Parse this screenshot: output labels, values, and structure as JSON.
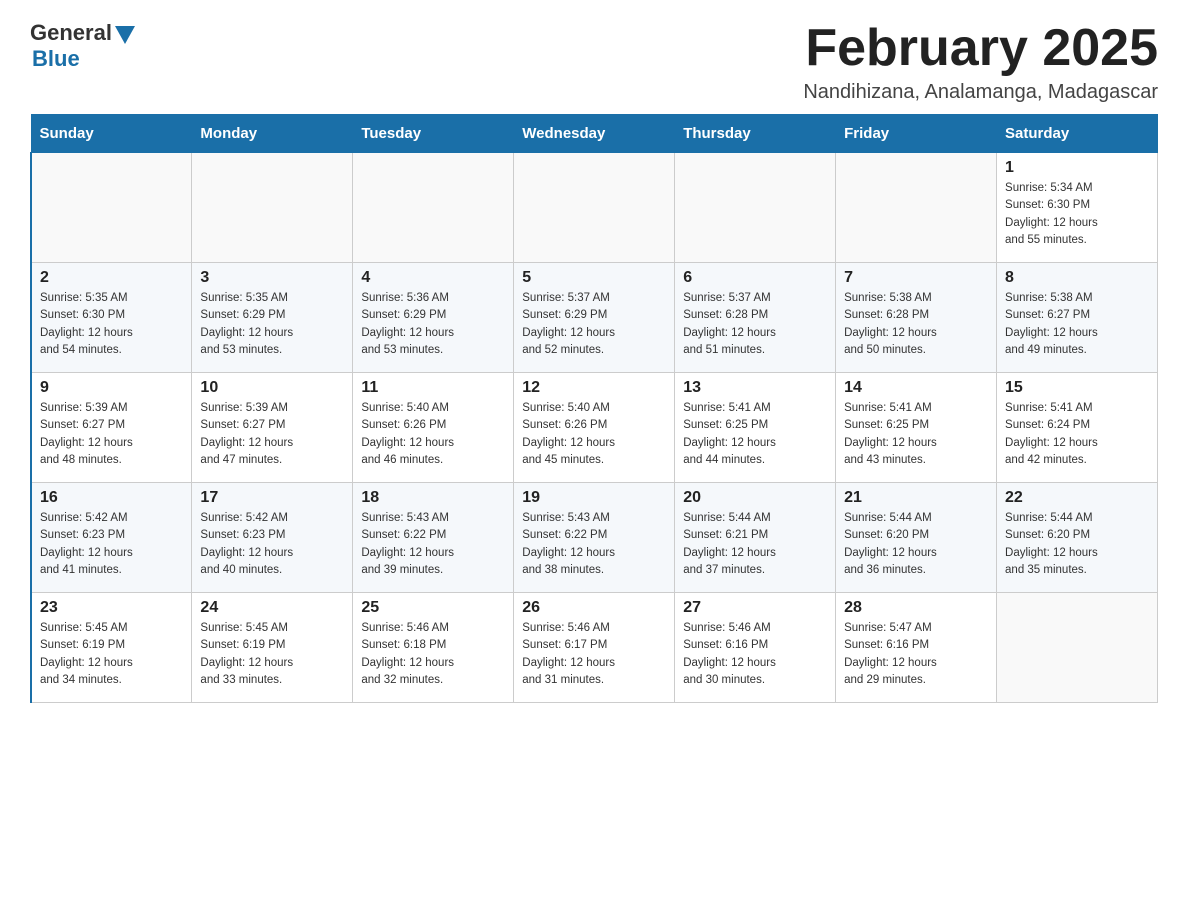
{
  "header": {
    "logo_general": "General",
    "logo_blue": "Blue",
    "month_title": "February 2025",
    "location": "Nandihizana, Analamanga, Madagascar"
  },
  "weekdays": [
    "Sunday",
    "Monday",
    "Tuesday",
    "Wednesday",
    "Thursday",
    "Friday",
    "Saturday"
  ],
  "weeks": [
    [
      {
        "day": "",
        "info": ""
      },
      {
        "day": "",
        "info": ""
      },
      {
        "day": "",
        "info": ""
      },
      {
        "day": "",
        "info": ""
      },
      {
        "day": "",
        "info": ""
      },
      {
        "day": "",
        "info": ""
      },
      {
        "day": "1",
        "info": "Sunrise: 5:34 AM\nSunset: 6:30 PM\nDaylight: 12 hours\nand 55 minutes."
      }
    ],
    [
      {
        "day": "2",
        "info": "Sunrise: 5:35 AM\nSunset: 6:30 PM\nDaylight: 12 hours\nand 54 minutes."
      },
      {
        "day": "3",
        "info": "Sunrise: 5:35 AM\nSunset: 6:29 PM\nDaylight: 12 hours\nand 53 minutes."
      },
      {
        "day": "4",
        "info": "Sunrise: 5:36 AM\nSunset: 6:29 PM\nDaylight: 12 hours\nand 53 minutes."
      },
      {
        "day": "5",
        "info": "Sunrise: 5:37 AM\nSunset: 6:29 PM\nDaylight: 12 hours\nand 52 minutes."
      },
      {
        "day": "6",
        "info": "Sunrise: 5:37 AM\nSunset: 6:28 PM\nDaylight: 12 hours\nand 51 minutes."
      },
      {
        "day": "7",
        "info": "Sunrise: 5:38 AM\nSunset: 6:28 PM\nDaylight: 12 hours\nand 50 minutes."
      },
      {
        "day": "8",
        "info": "Sunrise: 5:38 AM\nSunset: 6:27 PM\nDaylight: 12 hours\nand 49 minutes."
      }
    ],
    [
      {
        "day": "9",
        "info": "Sunrise: 5:39 AM\nSunset: 6:27 PM\nDaylight: 12 hours\nand 48 minutes."
      },
      {
        "day": "10",
        "info": "Sunrise: 5:39 AM\nSunset: 6:27 PM\nDaylight: 12 hours\nand 47 minutes."
      },
      {
        "day": "11",
        "info": "Sunrise: 5:40 AM\nSunset: 6:26 PM\nDaylight: 12 hours\nand 46 minutes."
      },
      {
        "day": "12",
        "info": "Sunrise: 5:40 AM\nSunset: 6:26 PM\nDaylight: 12 hours\nand 45 minutes."
      },
      {
        "day": "13",
        "info": "Sunrise: 5:41 AM\nSunset: 6:25 PM\nDaylight: 12 hours\nand 44 minutes."
      },
      {
        "day": "14",
        "info": "Sunrise: 5:41 AM\nSunset: 6:25 PM\nDaylight: 12 hours\nand 43 minutes."
      },
      {
        "day": "15",
        "info": "Sunrise: 5:41 AM\nSunset: 6:24 PM\nDaylight: 12 hours\nand 42 minutes."
      }
    ],
    [
      {
        "day": "16",
        "info": "Sunrise: 5:42 AM\nSunset: 6:23 PM\nDaylight: 12 hours\nand 41 minutes."
      },
      {
        "day": "17",
        "info": "Sunrise: 5:42 AM\nSunset: 6:23 PM\nDaylight: 12 hours\nand 40 minutes."
      },
      {
        "day": "18",
        "info": "Sunrise: 5:43 AM\nSunset: 6:22 PM\nDaylight: 12 hours\nand 39 minutes."
      },
      {
        "day": "19",
        "info": "Sunrise: 5:43 AM\nSunset: 6:22 PM\nDaylight: 12 hours\nand 38 minutes."
      },
      {
        "day": "20",
        "info": "Sunrise: 5:44 AM\nSunset: 6:21 PM\nDaylight: 12 hours\nand 37 minutes."
      },
      {
        "day": "21",
        "info": "Sunrise: 5:44 AM\nSunset: 6:20 PM\nDaylight: 12 hours\nand 36 minutes."
      },
      {
        "day": "22",
        "info": "Sunrise: 5:44 AM\nSunset: 6:20 PM\nDaylight: 12 hours\nand 35 minutes."
      }
    ],
    [
      {
        "day": "23",
        "info": "Sunrise: 5:45 AM\nSunset: 6:19 PM\nDaylight: 12 hours\nand 34 minutes."
      },
      {
        "day": "24",
        "info": "Sunrise: 5:45 AM\nSunset: 6:19 PM\nDaylight: 12 hours\nand 33 minutes."
      },
      {
        "day": "25",
        "info": "Sunrise: 5:46 AM\nSunset: 6:18 PM\nDaylight: 12 hours\nand 32 minutes."
      },
      {
        "day": "26",
        "info": "Sunrise: 5:46 AM\nSunset: 6:17 PM\nDaylight: 12 hours\nand 31 minutes."
      },
      {
        "day": "27",
        "info": "Sunrise: 5:46 AM\nSunset: 6:16 PM\nDaylight: 12 hours\nand 30 minutes."
      },
      {
        "day": "28",
        "info": "Sunrise: 5:47 AM\nSunset: 6:16 PM\nDaylight: 12 hours\nand 29 minutes."
      },
      {
        "day": "",
        "info": ""
      }
    ]
  ]
}
